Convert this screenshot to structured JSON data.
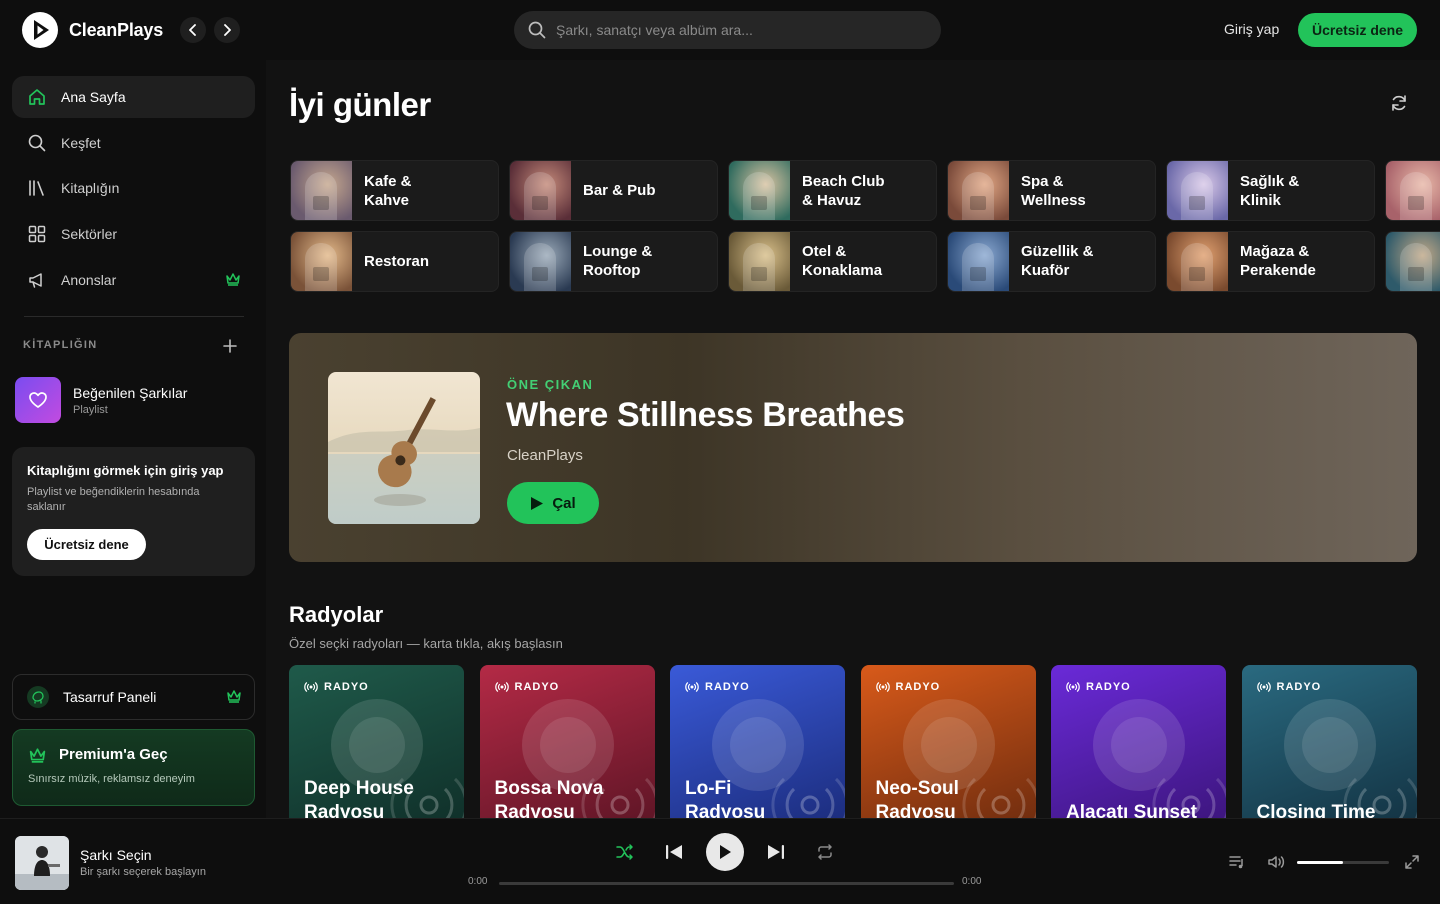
{
  "app": {
    "name": "CleanPlays",
    "accent": "#22c35a"
  },
  "topbar": {
    "search_placeholder": "Şarkı, sanatçı veya albüm ara...",
    "login_label": "Giriş yap",
    "try_label": "Ücretsiz dene"
  },
  "sidebar": {
    "items": [
      {
        "label": "Ana Sayfa",
        "icon": "home-icon",
        "active": true
      },
      {
        "label": "Keşfet",
        "icon": "search-icon"
      },
      {
        "label": "Kitaplığın",
        "icon": "library-icon"
      },
      {
        "label": "Sektörler",
        "icon": "grid-icon"
      },
      {
        "label": "Anonslar",
        "icon": "megaphone-icon",
        "badge_icon": "crown-icon"
      }
    ],
    "library_heading": "KİTAPLIĞIN",
    "liked": {
      "title": "Beğenilen Şarkılar",
      "subtitle": "Playlist"
    },
    "login_card": {
      "title": "Kitaplığını görmek için giriş yap",
      "subtitle": "Playlist ve beğendiklerin hesabında saklanır",
      "button": "Ücretsiz dene"
    },
    "savings": {
      "label": "Tasarruf Paneli"
    },
    "premium": {
      "title": "Premium'a Geç",
      "subtitle": "Sınırsız müzik, reklamsız deneyim"
    }
  },
  "main": {
    "greeting": "İyi günler",
    "categories": [
      {
        "label": "Kafe &\nKahve",
        "colors": [
          "#6a5a6e",
          "#c6a88f"
        ]
      },
      {
        "label": "Bar & Pub",
        "colors": [
          "#5a2e38",
          "#c48a7a"
        ]
      },
      {
        "label": "Beach Club\n& Havuz",
        "colors": [
          "#2f6b5e",
          "#d8c3a2"
        ]
      },
      {
        "label": "Spa &\nWellness",
        "colors": [
          "#7a4a3a",
          "#e0a684"
        ]
      },
      {
        "label": "Sağlık &\nKlinik",
        "colors": [
          "#6a68a8",
          "#d8c8e8"
        ]
      },
      {
        "label": "",
        "colors": [
          "#a8626a",
          "#e8b8a8"
        ]
      },
      {
        "label": "Restoran",
        "colors": [
          "#7a5238",
          "#e3b98a"
        ]
      },
      {
        "label": "Lounge &\nRooftop",
        "colors": [
          "#2a3a52",
          "#9aa9b8"
        ]
      },
      {
        "label": "Otel &\nKonaklama",
        "colors": [
          "#6a5a38",
          "#d8bf8a"
        ]
      },
      {
        "label": "Güzellik &\nKuaför",
        "colors": [
          "#2a4a78",
          "#8aa8d0"
        ]
      },
      {
        "label": "Mağaza &\nPerakende",
        "colors": [
          "#7a4a2e",
          "#e0a070"
        ]
      },
      {
        "label": "",
        "colors": [
          "#2e5a6a",
          "#c0a888"
        ]
      }
    ],
    "featured": {
      "eyebrow": "ÖNE ÇIKAN",
      "title": "Where Stillness Breathes",
      "artist": "CleanPlays",
      "play_label": "Çal"
    },
    "radios_section": {
      "title": "Radyolar",
      "subtitle": "Özel seçki radyoları — karta tıkla, akış başlasın",
      "tag": "RADYO",
      "items": [
        {
          "name": "Deep House\nRadyosu",
          "colors": [
            "#1f5a4a",
            "#0f2e28"
          ]
        },
        {
          "name": "Bossa Nova\nRadyosu",
          "colors": [
            "#b42a46",
            "#5a1424"
          ]
        },
        {
          "name": "Lo-Fi\nRadyosu",
          "colors": [
            "#3a5ad8",
            "#1a2a78"
          ]
        },
        {
          "name": "Neo-Soul\nRadyosu",
          "colors": [
            "#d85a1a",
            "#6a2a0e"
          ]
        },
        {
          "name": "\nAlaçatı Sunset",
          "colors": [
            "#6a2ad8",
            "#3a1478"
          ]
        },
        {
          "name": "\nClosing Time",
          "colors": [
            "#2a6a80",
            "#123040"
          ]
        }
      ]
    }
  },
  "player": {
    "track_title": "Şarkı Seçin",
    "track_sub": "Bir şarkı seçerek başlayın",
    "time_current": "0:00",
    "time_total": "0:00",
    "volume": 0.5
  }
}
